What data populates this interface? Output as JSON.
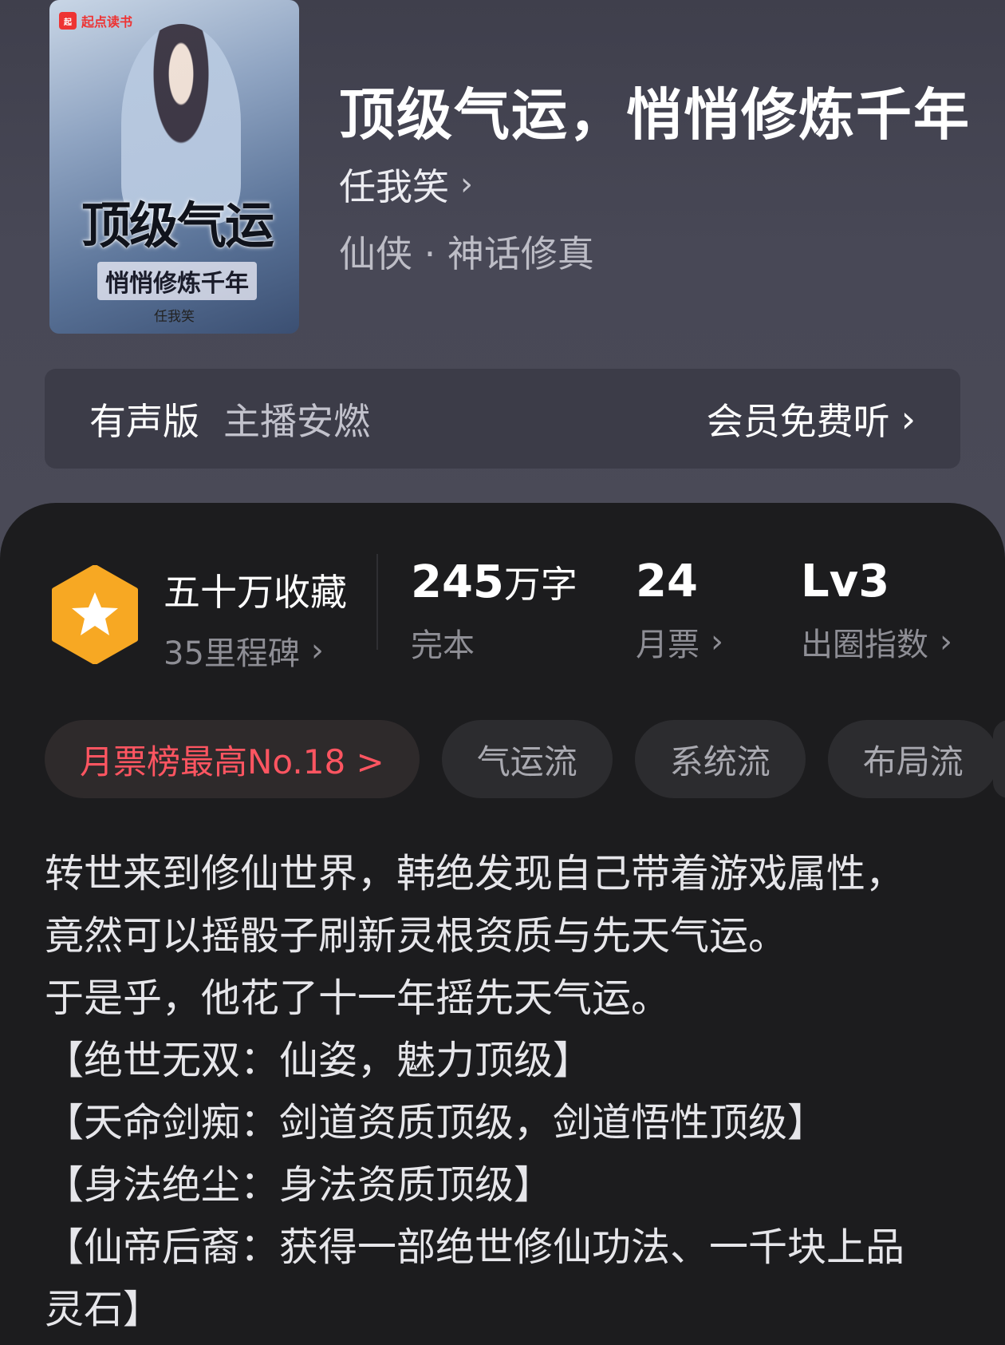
{
  "book": {
    "title": "顶级气运，悄悄修炼千年",
    "author": "任我笑",
    "genre": "仙侠 · 神话修真",
    "cover": {
      "brand": "起点读书",
      "title_line1": "顶级气运",
      "title_line2": "悄悄修炼千年",
      "author": "任我笑"
    }
  },
  "audio": {
    "label": "有声版",
    "host": "主播安燃",
    "action": "会员免费听"
  },
  "stats": {
    "collection": {
      "title": "五十万收藏",
      "sub": "35里程碑"
    },
    "words": {
      "value": "245",
      "unit": "万字",
      "sub": "完本"
    },
    "monthly_votes": {
      "value": "24",
      "sub": "月票"
    },
    "influence": {
      "value": "Lv3",
      "sub": "出圈指数"
    }
  },
  "tags": [
    "月票榜最高No.18 >",
    "气运流",
    "系统流",
    "布局流"
  ],
  "synopsis": [
    "转世来到修仙世界，韩绝发现自己带着游戏属性，",
    "竟然可以摇骰子刷新灵根资质与先天气运。",
    "于是乎，他花了十一年摇先天气运。",
    "【绝世无双：仙姿，魅力顶级】",
    "【天命剑痴：剑道资质顶级，剑道悟性顶级】",
    "【身法绝尘：身法资质顶级】",
    "【仙帝后裔：获得一部绝世修仙功法、一千块上品",
    "灵石】"
  ],
  "colors": {
    "accent_red": "#ff5561",
    "badge_orange": "#f7a823",
    "panel_bg": "#1c1c1e",
    "header_bg": "#484856"
  },
  "icons": [
    "chevron-right-icon",
    "star-badge-icon"
  ]
}
